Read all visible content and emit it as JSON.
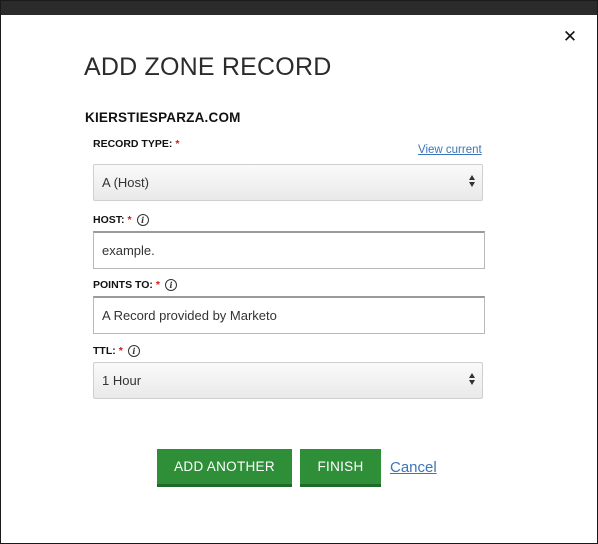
{
  "dialog": {
    "close_glyph": "✕",
    "title": "ADD ZONE RECORD",
    "domain": "KIERSTIESPARZA.COM"
  },
  "record_type": {
    "label": "RECORD TYPE:",
    "required_mark": "*",
    "view_current": "View current",
    "value": "A (Host)"
  },
  "host": {
    "label": "HOST:",
    "required_mark": "*",
    "info_glyph": "i",
    "value": "example."
  },
  "points_to": {
    "label": "POINTS TO:",
    "required_mark": "*",
    "info_glyph": "i",
    "value": "A Record provided by Marketo"
  },
  "ttl": {
    "label": "TTL:",
    "required_mark": "*",
    "info_glyph": "i",
    "value": "1 Hour"
  },
  "actions": {
    "add_another": "ADD ANOTHER",
    "finish": "FINISH",
    "cancel": "Cancel"
  },
  "colors": {
    "primary_button": "#2f8f39",
    "link": "#3a75b8",
    "required": "#d21a1a"
  },
  "icons": {
    "close": "close-icon",
    "info": "info-icon",
    "select_arrows": "select-arrows-icon"
  }
}
